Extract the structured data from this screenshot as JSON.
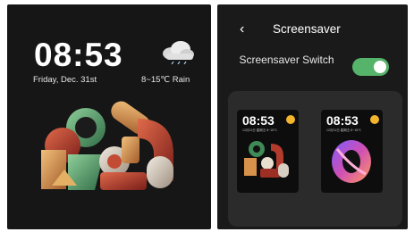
{
  "lockscreen": {
    "time": "08:53",
    "date": "Friday, Dec. 31st",
    "weather": "8~15℃ Rain",
    "weather_icon": "cloud-rain-icon"
  },
  "settings": {
    "back_icon": "‹",
    "title": "Screensaver",
    "switch_label": "Screensaver Switch",
    "switch_on": true,
    "accent_color": "#56b36a",
    "previews": [
      {
        "time": "08:53",
        "meta": "12月31日 星期五   8~15℃"
      },
      {
        "time": "08:53",
        "meta": "12月31日 星期五   8~15℃"
      }
    ]
  }
}
